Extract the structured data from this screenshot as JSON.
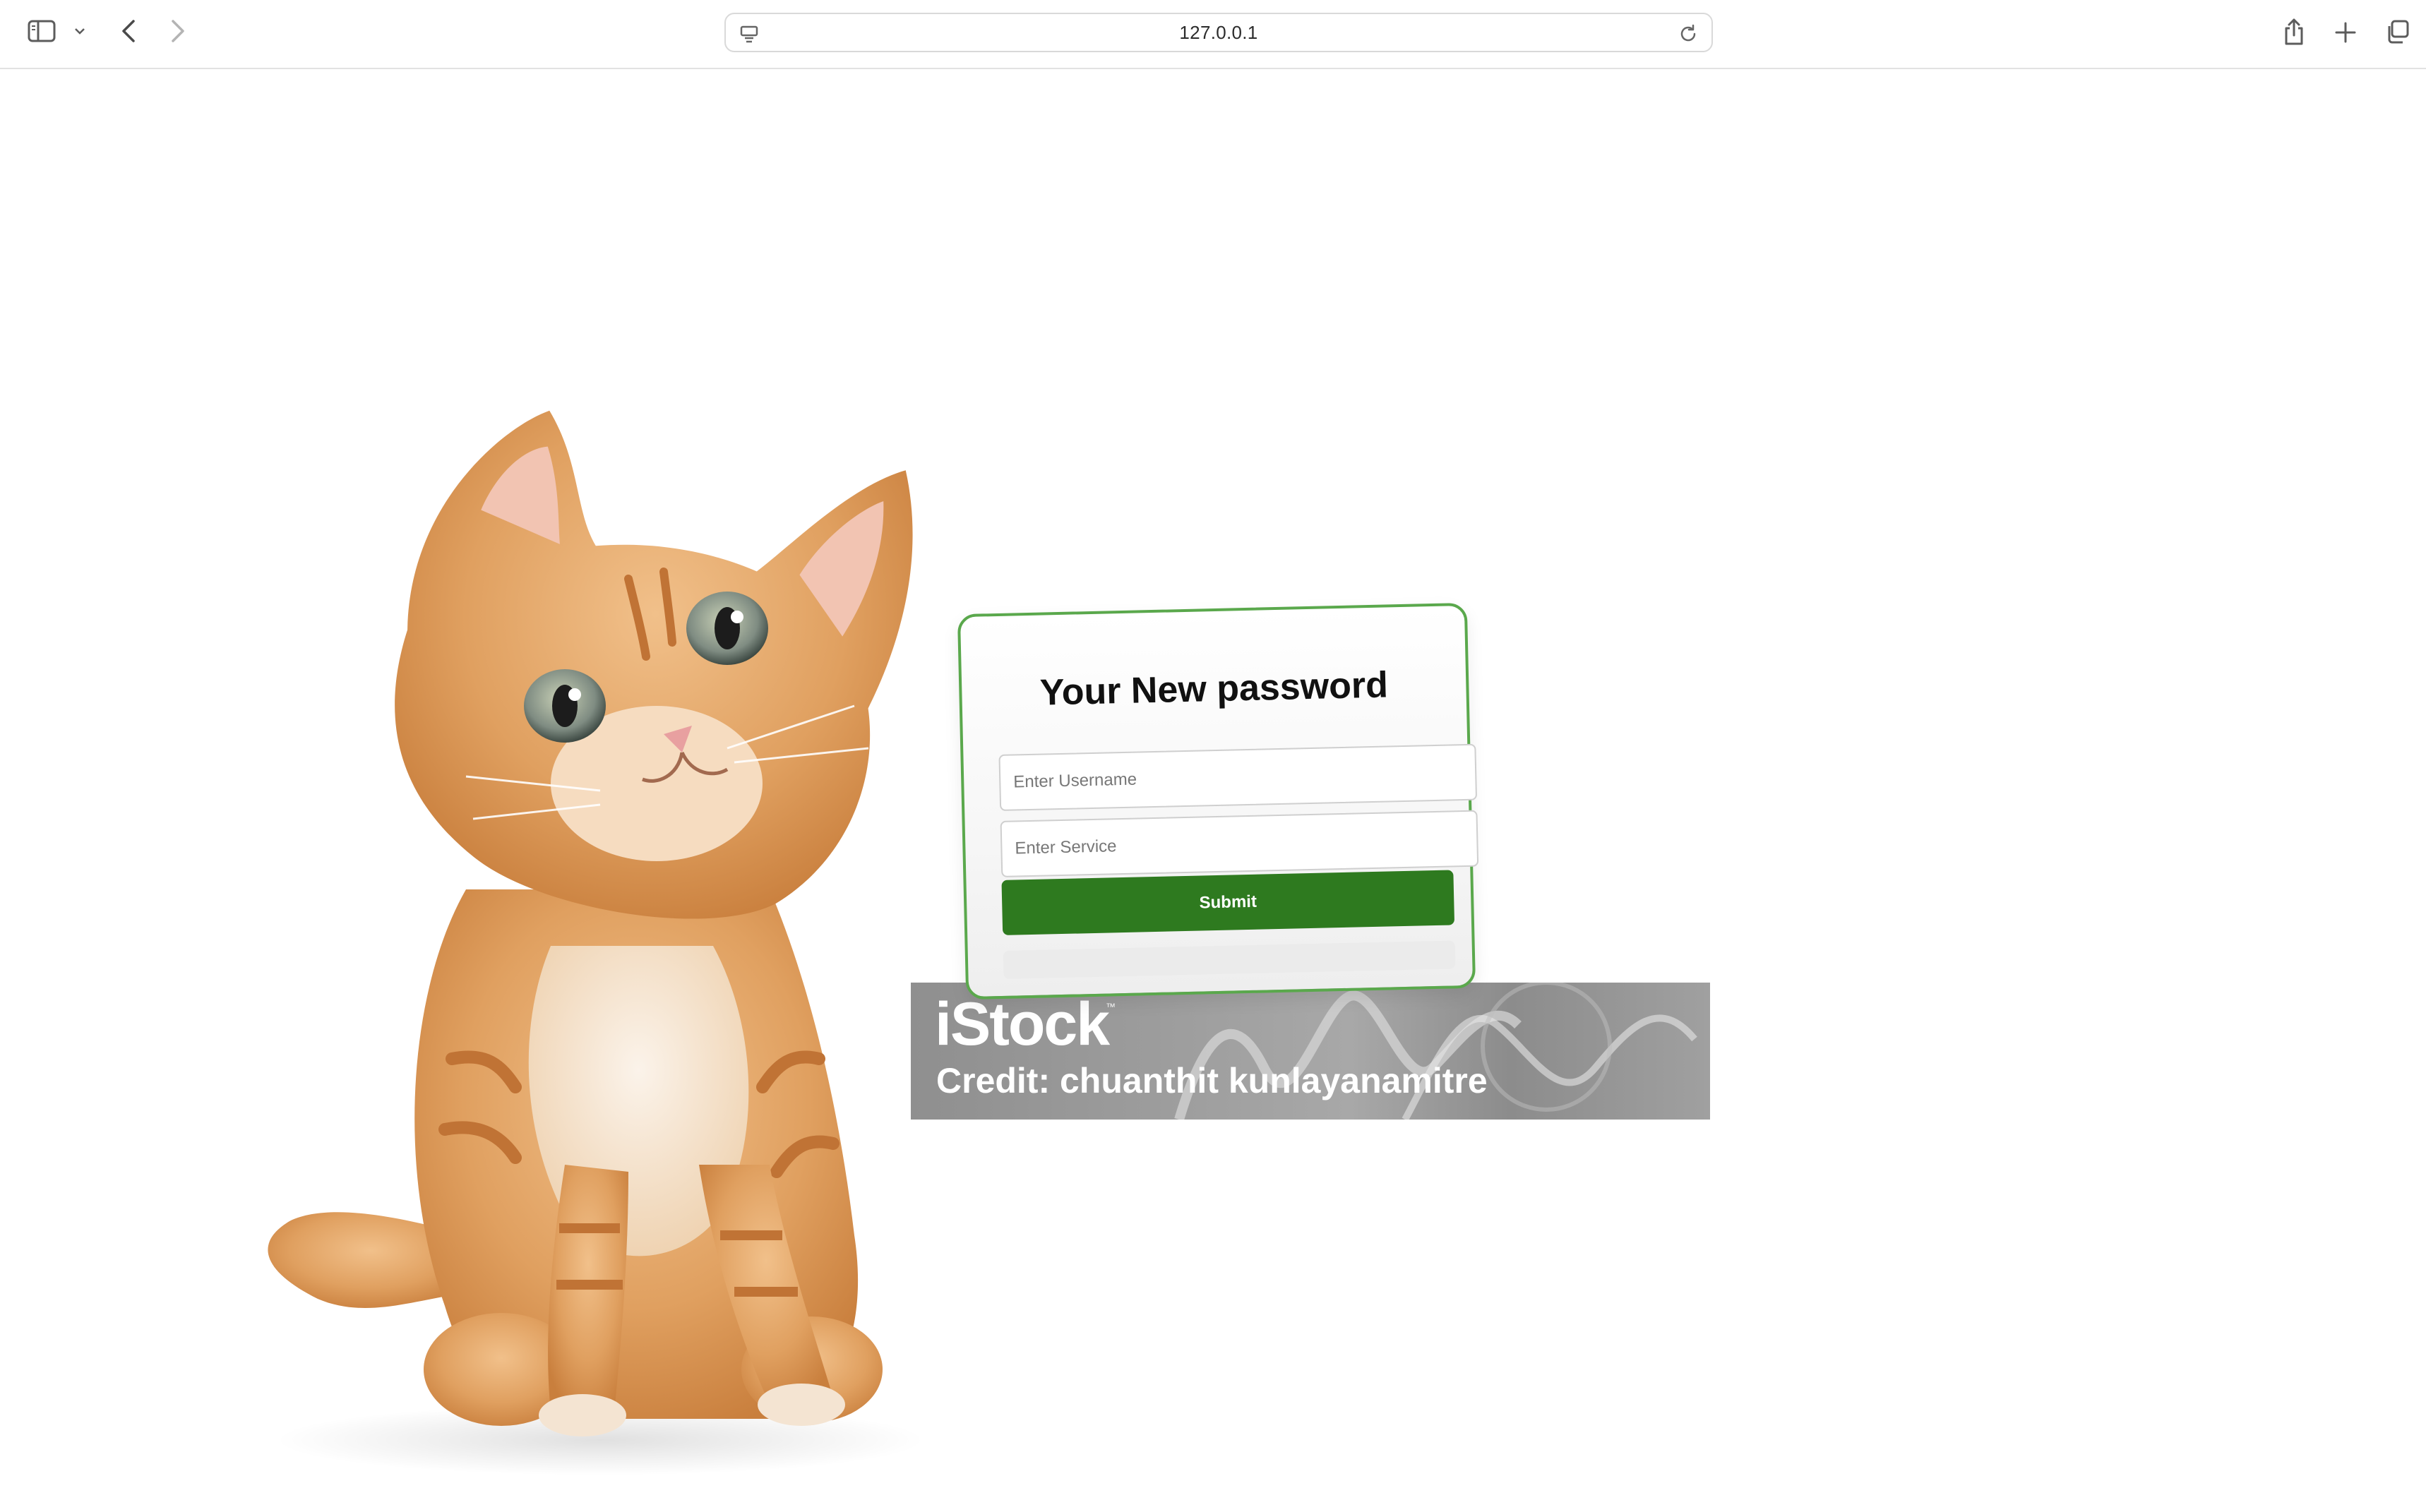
{
  "browser": {
    "address": "127.0.0.1",
    "icons": {
      "sidebar": "sidebar-icon",
      "sidebar_menu": "chevron-down-icon",
      "back": "back-arrow-icon",
      "forward": "forward-arrow-icon",
      "site": "site-settings-icon",
      "reload": "reload-icon",
      "share": "share-icon",
      "new_tab": "plus-icon",
      "tab_overview": "tabs-icon"
    }
  },
  "page": {
    "image_alt": "kitten-photo",
    "watermark": {
      "logo": "iStock",
      "trademark": "™",
      "credit": "Credit: chuanthit kunlayanamitre"
    },
    "form": {
      "title": "Your New password",
      "username_placeholder": "Enter Username",
      "service_placeholder": "Enter Service",
      "submit_label": "Submit"
    }
  },
  "colors": {
    "accent_green": "#2e7a1f",
    "card_border": "#5aa84c",
    "kitten_fur": "#e0a060"
  }
}
